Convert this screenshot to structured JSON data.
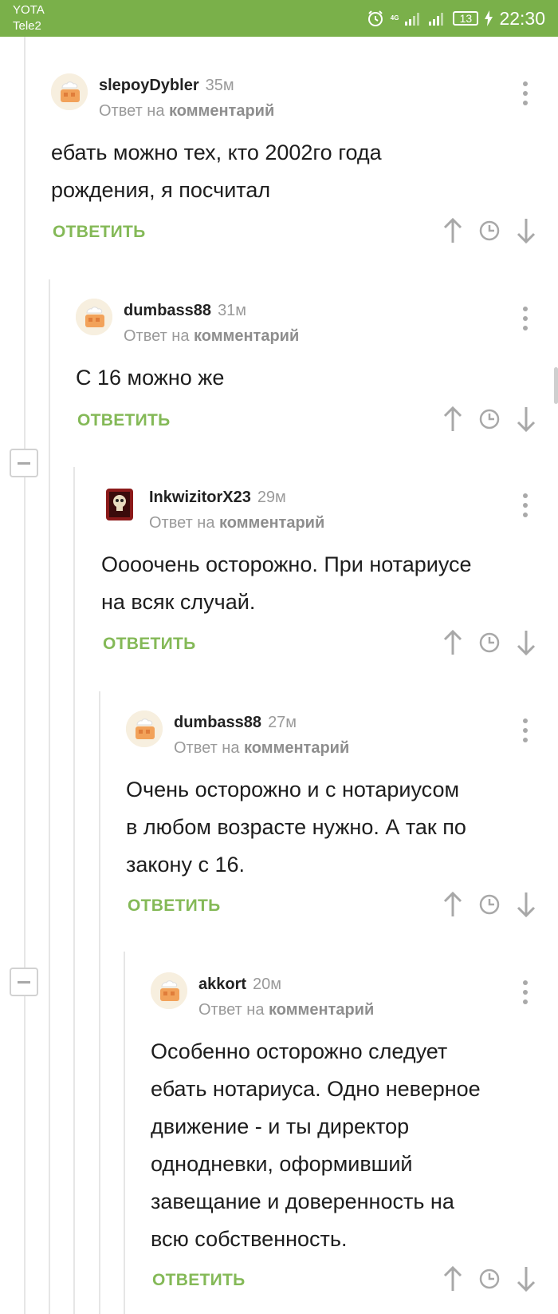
{
  "status_bar": {
    "carrier_1": "YOTA",
    "carrier_2": "Tele2",
    "network": "4G",
    "battery": "13",
    "time": "22:30"
  },
  "labels": {
    "reply_prefix": "Ответ на",
    "reply_target": "комментарий",
    "reply_button": "ОТВЕТИТЬ"
  },
  "comments": [
    {
      "username": "slepoyDybler",
      "time": "35м",
      "lines": [
        "ебать можно тех, кто 2002го года",
        "рождения, я посчитал"
      ]
    },
    {
      "username": "dumbass88",
      "time": "31м",
      "lines": [
        "С 16 можно же"
      ]
    },
    {
      "username": "InkwizitorX23",
      "time": "29м",
      "lines": [
        "Оооочень осторожно. При нотариусе",
        "на всяк случай."
      ]
    },
    {
      "username": "dumbass88",
      "time": "27м",
      "lines": [
        "Очень осторожно и с нотариусом",
        "в любом возрасте нужно. А так по",
        "закону с 16."
      ]
    },
    {
      "username": "akkort",
      "time": "20м",
      "lines": [
        "Особенно осторожно следует",
        "ебать нотариуса. Одно неверное",
        "движение - и ты директор",
        "однодневки, оформивший",
        "завещание и доверенность на",
        "всю собственность."
      ]
    }
  ],
  "colors": {
    "status_bar": "#7ab04a",
    "reply_button": "#84b957",
    "thread_line": "#e6e6e6"
  }
}
